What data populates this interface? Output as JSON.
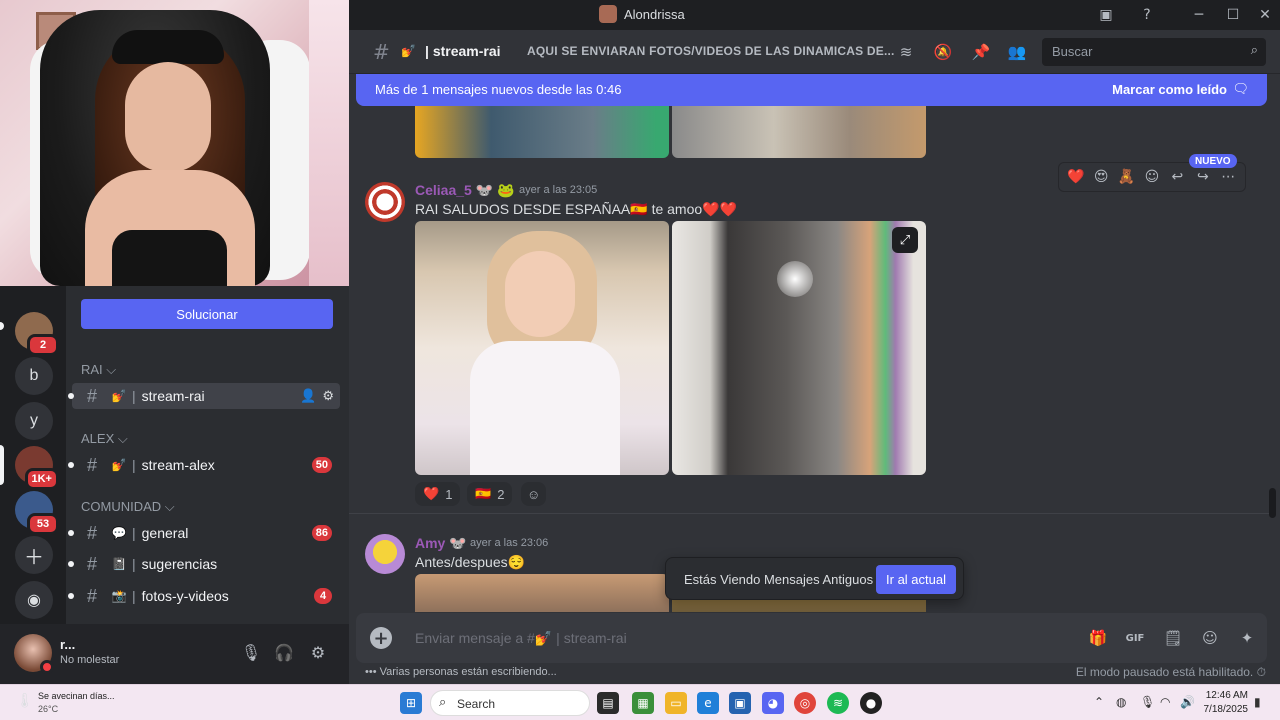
{
  "window": {
    "title": "Alondrissa"
  },
  "channel": {
    "name": "stream-rai",
    "emoji": "💅",
    "topic": "AQUI SE ENVIARAN FOTOS/VIDEOS DE LAS DINAMICAS DE..."
  },
  "search": {
    "placeholder": "Buscar"
  },
  "banner": {
    "text": "Más de 1 mensajes nuevos desde las 0:46",
    "action": "Marcar como leído"
  },
  "sidebar": {
    "solve_button": "Solucionar",
    "categories": [
      {
        "label": "RAI ⌵"
      },
      {
        "label": "ALEX ⌵"
      },
      {
        "label": "COMUNIDAD ⌵"
      }
    ],
    "channels": [
      {
        "name": "stream-rai",
        "emoji": "💅",
        "count": ""
      },
      {
        "name": "stream-alex",
        "emoji": "💅",
        "count": "50"
      },
      {
        "name": "general",
        "emoji": "💬",
        "count": "86"
      },
      {
        "name": "sugerencias",
        "emoji": "📓",
        "count": ""
      },
      {
        "name": "fotos-y-videos",
        "emoji": "📸",
        "count": "4"
      }
    ]
  },
  "servers": [
    {
      "label": "",
      "badge": "2"
    },
    {
      "label": "b",
      "badge": ""
    },
    {
      "label": "y",
      "badge": ""
    },
    {
      "label": "",
      "badge": "1K+"
    },
    {
      "label": "",
      "badge": "53"
    }
  ],
  "user": {
    "name": "r...",
    "status": "No molestar"
  },
  "messages": [
    {
      "author": "Celiaa_5",
      "author_color": "#9b59b6",
      "timestamp": "ayer a las 23:05",
      "text": "RAI SALUDOS DESDE ESPAÑAA🇪🇸 te amoo❤️❤️",
      "reactions": [
        {
          "emoji": "❤️",
          "count": "1"
        },
        {
          "emoji": "🇪🇸",
          "count": "2"
        }
      ],
      "new_label": "NUEVO"
    },
    {
      "author": "Amy",
      "author_color": "#9b59b6",
      "timestamp": "ayer a las 23:06",
      "text": "Antes/despues😌"
    }
  ],
  "toast": {
    "text": "Estás Viendo Mensajes Antiguos",
    "action": "Ir al actual"
  },
  "composer": {
    "placeholder": "Enviar mensaje a #💅 | stream-rai"
  },
  "footer": {
    "typing": "Varias personas están escribiendo...",
    "paused": "El modo pausado está habilitado."
  },
  "taskbar": {
    "weather_title": "Se avecinan días...",
    "weather_temp": "26°C",
    "search_label": "Search",
    "time": "12:46 AM",
    "date": "7/18/2025"
  },
  "colors": {
    "accent": "#5865f2",
    "badge": "#da373c",
    "username": "#9b59b6"
  }
}
